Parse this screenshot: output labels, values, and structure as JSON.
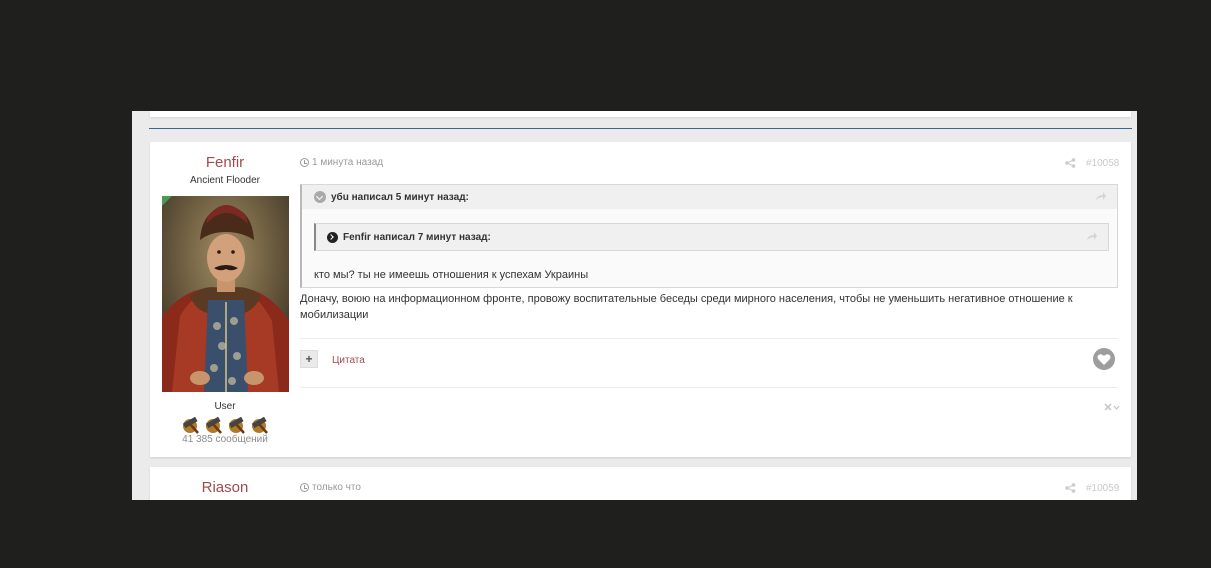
{
  "posts": [
    {
      "author": {
        "name": "Fenfir",
        "title": "Ancient Flooder",
        "group": "User",
        "post_count": "41 385 сообщений",
        "rank_icon_count": 4
      },
      "time": "1 минута назад",
      "post_number": "#10058",
      "quote": {
        "author_line": "убu написал 5 минут назад:",
        "nested_quote": {
          "author_line": "Fenfir написал 7 минут назад:"
        },
        "text": "кто мы? ты не имеешь отношения к успехам Украины"
      },
      "body": "Доначу, воюю на информационном фронте, провожу воспитательные беседы среди мирного населения, чтобы не уменьшить негативное отношение к мобилизации",
      "actions": {
        "plus_label": "+",
        "quote_label": "Цитата"
      }
    },
    {
      "author": {
        "name": "Riason"
      },
      "time": "только что",
      "post_number": "#10059"
    }
  ],
  "colors": {
    "page_background": "#1f201d",
    "author_name": "#a44a4a",
    "divider": "#3d6594"
  },
  "icons": {
    "time": "clock-icon",
    "share": "share-icon",
    "quote_toggle": "chevron-down-icon",
    "nested_quote_toggle": "chevron-right-icon",
    "like": "heart-icon",
    "moderate": "close-icon"
  }
}
